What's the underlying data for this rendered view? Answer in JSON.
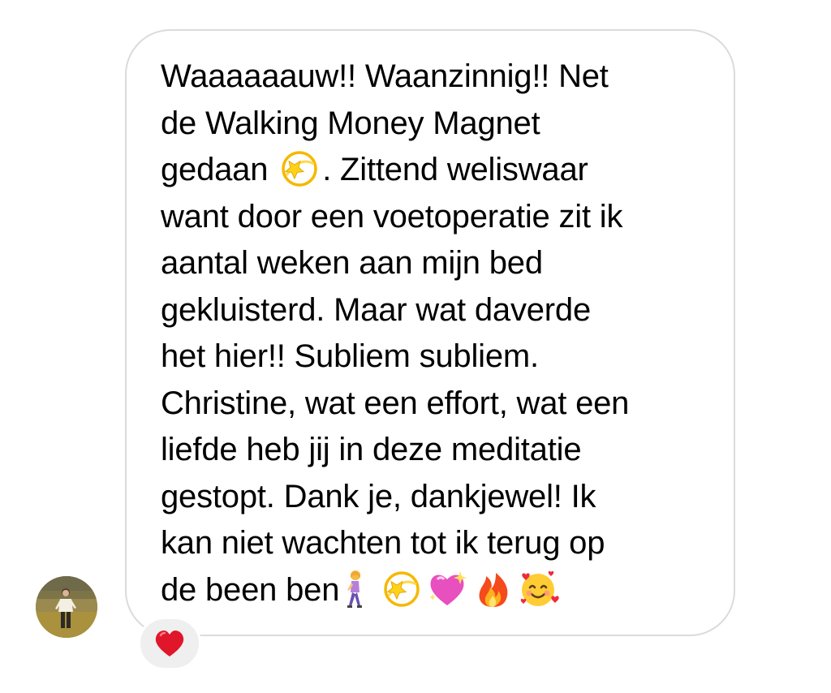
{
  "message": {
    "lines": [
      "Waaaaaauw!! Waanzinnig!! Net",
      "de Walking Money Magnet",
      "gedaan",
      ". Zittend weliswaar",
      "want door een voetoperatie zit ik",
      "aantal weken aan mijn bed",
      "gekluisterd. Maar wat daverde",
      "het hier!! Subliem subliem.",
      "Christine, wat een effort, wat een",
      "liefde heb jij in deze meditatie",
      "gestopt. Dank je, dankjewel! Ik",
      "kan niet wachten tot ik terug op",
      "de been ben"
    ],
    "inline_emoji": [
      {
        "name": "dizzy-emoji",
        "char": "💫"
      },
      {
        "name": "woman-walking-emoji",
        "char": "🚶‍♀️"
      },
      {
        "name": "dizzy-emoji",
        "char": "💫"
      },
      {
        "name": "sparkling-heart-emoji",
        "char": "💖"
      },
      {
        "name": "fire-emoji",
        "char": "🔥"
      },
      {
        "name": "smiling-face-with-hearts-emoji",
        "char": "🥰"
      }
    ]
  },
  "reaction": {
    "icon": "red-heart-emoji",
    "color": "#e0162b"
  },
  "colors": {
    "bubble_border": "#dbdbdb",
    "text": "#000000",
    "reaction_bg": "#efefef"
  }
}
